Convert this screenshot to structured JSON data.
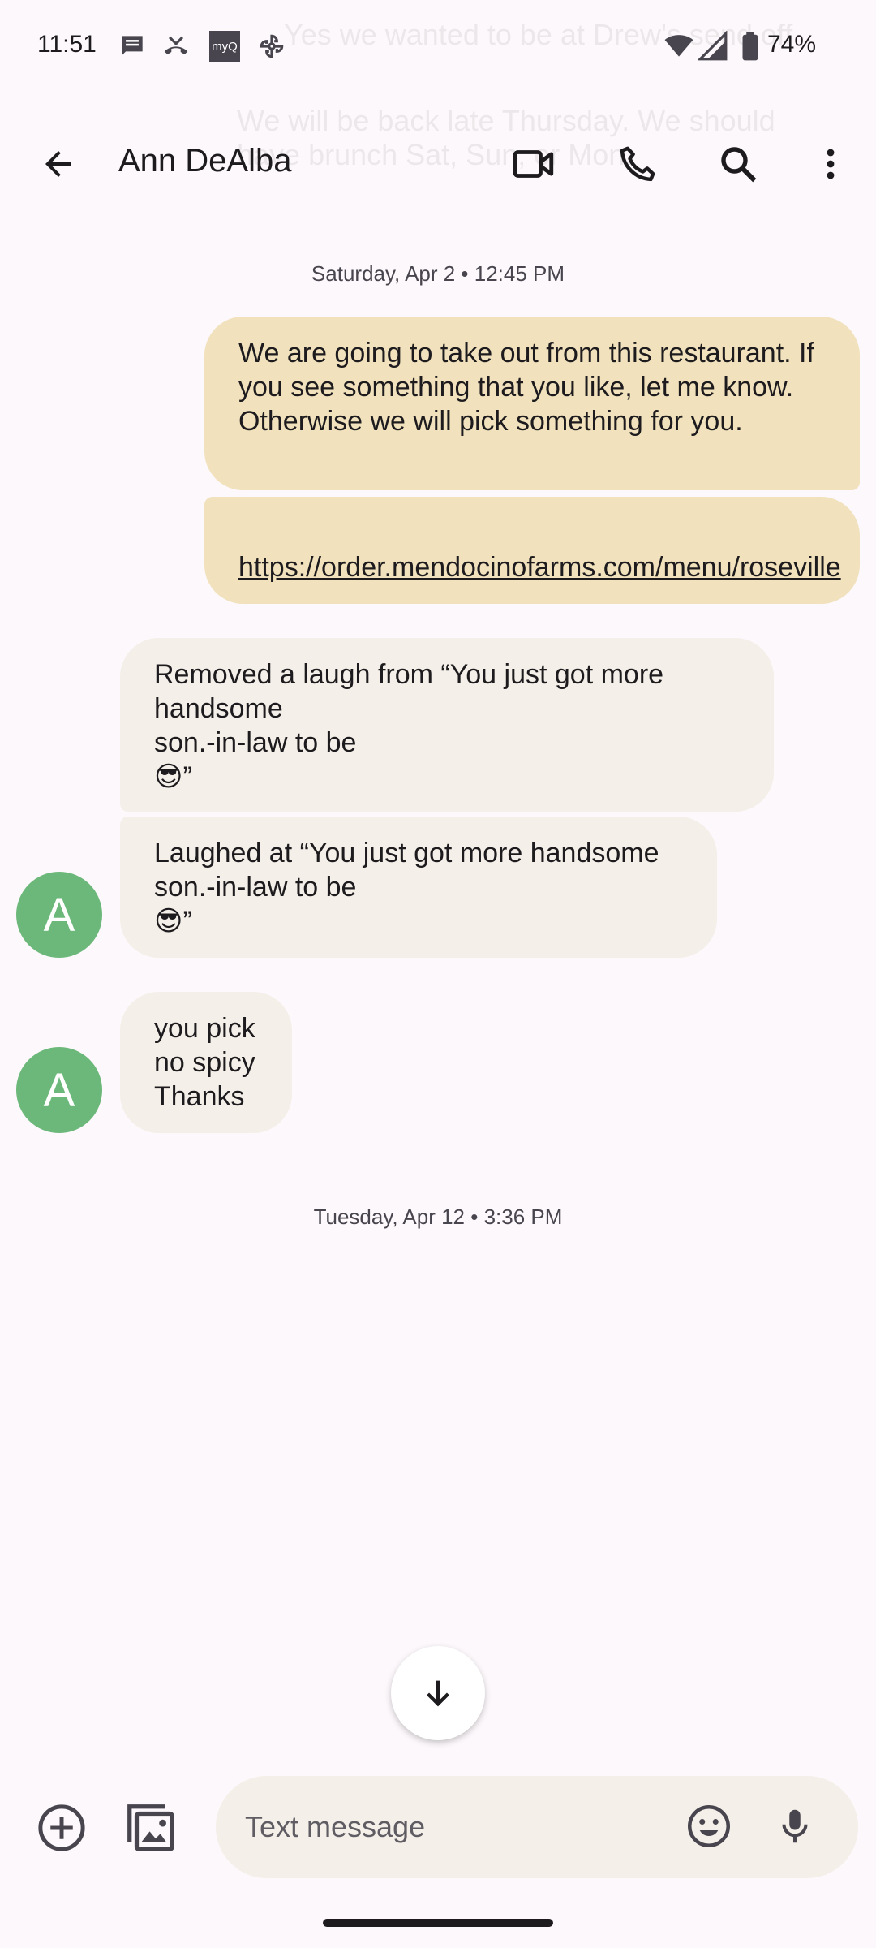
{
  "status_bar": {
    "time": "11:51",
    "battery": "74%",
    "icons": [
      "messages-notification-icon",
      "missed-call-icon",
      "myq-app-icon",
      "pinwheel-icon",
      "wifi-icon",
      "cell-signal-icon",
      "battery-icon"
    ]
  },
  "overlay_preview": {
    "line1": "Yes we wanted to be at Drew's send off",
    "line2": "We will be back late Thursday. We should",
    "line3": "have brunch Sat, Sun, or Mon."
  },
  "header": {
    "contact_name": "Ann DeAlba",
    "actions": [
      "back-arrow-icon",
      "video-call-icon",
      "phone-icon",
      "search-icon",
      "more-vert-icon"
    ]
  },
  "conversation": {
    "timestamp_1": "Saturday, Apr 2 • 12:45 PM",
    "outgoing_1": "We are going to take out from this restaurant. If you see something that you like, let me know. Otherwise we will pick something for you.",
    "outgoing_2": "https://order.mendocinofarms.com/menu/roseville",
    "incoming_1": "Removed a laugh from “You just got more handsome\nson.-in-law to be\n😎”",
    "incoming_2": "Laughed at “You just got more handsome\nson.-in-law to be\n😎”",
    "incoming_3": "you pick\nno spicy\nThanks",
    "avatar_letter": "A",
    "timestamp_2": "Tuesday, Apr 12 • 3:36 PM"
  },
  "compose": {
    "placeholder": "Text message",
    "icons": [
      "add-circle-icon",
      "gallery-icon",
      "emoji-icon",
      "mic-icon"
    ]
  },
  "colors": {
    "background": "#fcf8fb",
    "outgoing_bubble": "#f1e2bd",
    "incoming_bubble": "#f4efe8",
    "avatar": "#6cb87a"
  }
}
